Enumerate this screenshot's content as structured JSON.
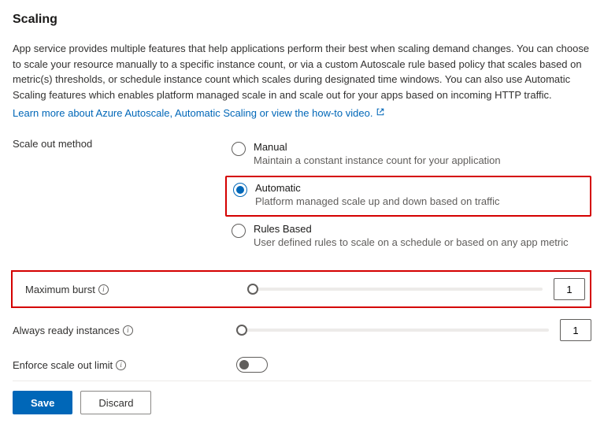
{
  "heading": "Scaling",
  "intro": "App service provides multiple features that help applications perform their best when scaling demand changes. You can choose to scale your resource manually to a specific instance count, or via a custom Autoscale rule based policy that scales based on metric(s) thresholds, or schedule instance count which scales during designated time windows. You can also use Automatic Scaling features which enables platform managed scale in and scale out for your apps based on incoming HTTP traffic.",
  "learn_link": "Learn more about Azure Autoscale, Automatic Scaling or view the how-to video.",
  "form": {
    "scale_method_label": "Scale out method",
    "radios": {
      "manual": {
        "title": "Manual",
        "desc": "Maintain a constant instance count for your application"
      },
      "automatic": {
        "title": "Automatic",
        "desc": "Platform managed scale up and down based on traffic"
      },
      "rules": {
        "title": "Rules Based",
        "desc": "User defined rules to scale on a schedule or based on any app metric"
      }
    },
    "max_burst": {
      "label": "Maximum burst",
      "value": "1"
    },
    "always_ready": {
      "label": "Always ready instances",
      "value": "1"
    },
    "enforce_limit": {
      "label": "Enforce scale out limit"
    }
  },
  "buttons": {
    "save": "Save",
    "discard": "Discard"
  },
  "info_glyph": "i"
}
